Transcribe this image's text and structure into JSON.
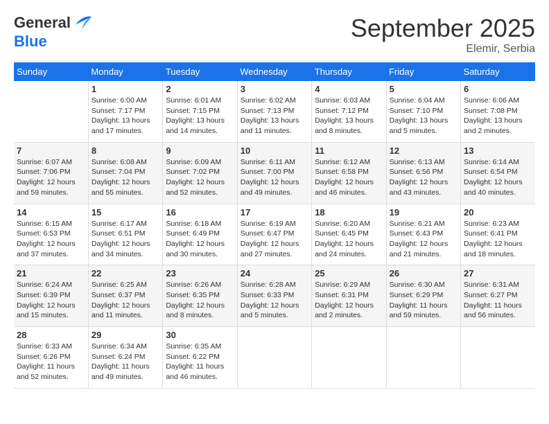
{
  "header": {
    "logo_general": "General",
    "logo_blue": "Blue",
    "month": "September 2025",
    "location": "Elemir, Serbia"
  },
  "days_of_week": [
    "Sunday",
    "Monday",
    "Tuesday",
    "Wednesday",
    "Thursday",
    "Friday",
    "Saturday"
  ],
  "weeks": [
    [
      {
        "day": "",
        "info": ""
      },
      {
        "day": "1",
        "info": "Sunrise: 6:00 AM\nSunset: 7:17 PM\nDaylight: 13 hours\nand 17 minutes."
      },
      {
        "day": "2",
        "info": "Sunrise: 6:01 AM\nSunset: 7:15 PM\nDaylight: 13 hours\nand 14 minutes."
      },
      {
        "day": "3",
        "info": "Sunrise: 6:02 AM\nSunset: 7:13 PM\nDaylight: 13 hours\nand 11 minutes."
      },
      {
        "day": "4",
        "info": "Sunrise: 6:03 AM\nSunset: 7:12 PM\nDaylight: 13 hours\nand 8 minutes."
      },
      {
        "day": "5",
        "info": "Sunrise: 6:04 AM\nSunset: 7:10 PM\nDaylight: 13 hours\nand 5 minutes."
      },
      {
        "day": "6",
        "info": "Sunrise: 6:06 AM\nSunset: 7:08 PM\nDaylight: 13 hours\nand 2 minutes."
      }
    ],
    [
      {
        "day": "7",
        "info": "Sunrise: 6:07 AM\nSunset: 7:06 PM\nDaylight: 12 hours\nand 59 minutes."
      },
      {
        "day": "8",
        "info": "Sunrise: 6:08 AM\nSunset: 7:04 PM\nDaylight: 12 hours\nand 55 minutes."
      },
      {
        "day": "9",
        "info": "Sunrise: 6:09 AM\nSunset: 7:02 PM\nDaylight: 12 hours\nand 52 minutes."
      },
      {
        "day": "10",
        "info": "Sunrise: 6:11 AM\nSunset: 7:00 PM\nDaylight: 12 hours\nand 49 minutes."
      },
      {
        "day": "11",
        "info": "Sunrise: 6:12 AM\nSunset: 6:58 PM\nDaylight: 12 hours\nand 46 minutes."
      },
      {
        "day": "12",
        "info": "Sunrise: 6:13 AM\nSunset: 6:56 PM\nDaylight: 12 hours\nand 43 minutes."
      },
      {
        "day": "13",
        "info": "Sunrise: 6:14 AM\nSunset: 6:54 PM\nDaylight: 12 hours\nand 40 minutes."
      }
    ],
    [
      {
        "day": "14",
        "info": "Sunrise: 6:15 AM\nSunset: 6:53 PM\nDaylight: 12 hours\nand 37 minutes."
      },
      {
        "day": "15",
        "info": "Sunrise: 6:17 AM\nSunset: 6:51 PM\nDaylight: 12 hours\nand 34 minutes."
      },
      {
        "day": "16",
        "info": "Sunrise: 6:18 AM\nSunset: 6:49 PM\nDaylight: 12 hours\nand 30 minutes."
      },
      {
        "day": "17",
        "info": "Sunrise: 6:19 AM\nSunset: 6:47 PM\nDaylight: 12 hours\nand 27 minutes."
      },
      {
        "day": "18",
        "info": "Sunrise: 6:20 AM\nSunset: 6:45 PM\nDaylight: 12 hours\nand 24 minutes."
      },
      {
        "day": "19",
        "info": "Sunrise: 6:21 AM\nSunset: 6:43 PM\nDaylight: 12 hours\nand 21 minutes."
      },
      {
        "day": "20",
        "info": "Sunrise: 6:23 AM\nSunset: 6:41 PM\nDaylight: 12 hours\nand 18 minutes."
      }
    ],
    [
      {
        "day": "21",
        "info": "Sunrise: 6:24 AM\nSunset: 6:39 PM\nDaylight: 12 hours\nand 15 minutes."
      },
      {
        "day": "22",
        "info": "Sunrise: 6:25 AM\nSunset: 6:37 PM\nDaylight: 12 hours\nand 11 minutes."
      },
      {
        "day": "23",
        "info": "Sunrise: 6:26 AM\nSunset: 6:35 PM\nDaylight: 12 hours\nand 8 minutes."
      },
      {
        "day": "24",
        "info": "Sunrise: 6:28 AM\nSunset: 6:33 PM\nDaylight: 12 hours\nand 5 minutes."
      },
      {
        "day": "25",
        "info": "Sunrise: 6:29 AM\nSunset: 6:31 PM\nDaylight: 12 hours\nand 2 minutes."
      },
      {
        "day": "26",
        "info": "Sunrise: 6:30 AM\nSunset: 6:29 PM\nDaylight: 11 hours\nand 59 minutes."
      },
      {
        "day": "27",
        "info": "Sunrise: 6:31 AM\nSunset: 6:27 PM\nDaylight: 11 hours\nand 56 minutes."
      }
    ],
    [
      {
        "day": "28",
        "info": "Sunrise: 6:33 AM\nSunset: 6:26 PM\nDaylight: 11 hours\nand 52 minutes."
      },
      {
        "day": "29",
        "info": "Sunrise: 6:34 AM\nSunset: 6:24 PM\nDaylight: 11 hours\nand 49 minutes."
      },
      {
        "day": "30",
        "info": "Sunrise: 6:35 AM\nSunset: 6:22 PM\nDaylight: 11 hours\nand 46 minutes."
      },
      {
        "day": "",
        "info": ""
      },
      {
        "day": "",
        "info": ""
      },
      {
        "day": "",
        "info": ""
      },
      {
        "day": "",
        "info": ""
      }
    ]
  ]
}
